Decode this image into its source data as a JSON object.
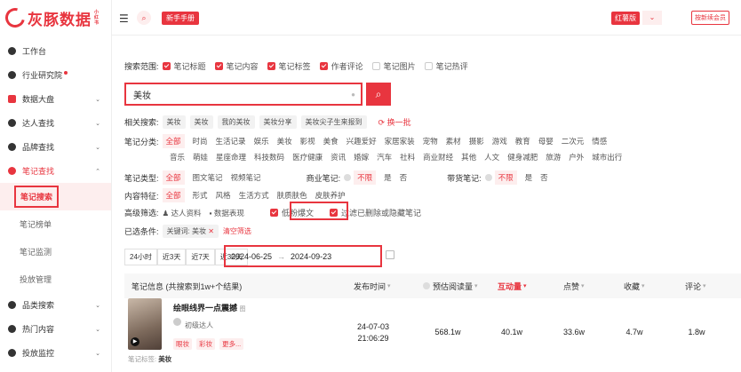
{
  "app": {
    "logo_text": "灰豚数据",
    "logo_small": [
      "小",
      "红",
      "书"
    ]
  },
  "sidebar": {
    "items": [
      {
        "label": "工作台",
        "chev": ""
      },
      {
        "label": "行业研究院",
        "chev": ""
      },
      {
        "label": "数据大盘",
        "chev": "⌄"
      },
      {
        "label": "达人查找",
        "chev": "⌄"
      },
      {
        "label": "品牌查找",
        "chev": "⌄"
      },
      {
        "label": "笔记查找",
        "chev": "⌃"
      }
    ],
    "subitems": [
      "笔记搜索",
      "笔记榜单",
      "笔记监测",
      "投放管理"
    ],
    "bottom": [
      {
        "label": "品类搜索",
        "chev": "⌄"
      },
      {
        "label": "热门内容",
        "chev": "⌄"
      },
      {
        "label": "投放监控",
        "chev": "⌄"
      }
    ]
  },
  "topbar": {
    "menu_icon": "☰",
    "search_icon": "⌕",
    "new_btn": "新手手册",
    "vip": "红薯版",
    "vip_chev": "⌄",
    "renew": "按新续会员"
  },
  "search": {
    "scope_label": "搜索范围:",
    "scope": [
      {
        "label": "笔记标题",
        "on": true
      },
      {
        "label": "笔记内容",
        "on": true
      },
      {
        "label": "笔记标签",
        "on": true
      },
      {
        "label": "作者评论",
        "on": true
      },
      {
        "label": "笔记图片",
        "on": false
      },
      {
        "label": "笔记热评",
        "on": false
      }
    ],
    "query": "美妆",
    "clear_icon": "●",
    "button_icon": "⌕"
  },
  "related": {
    "label": "相关搜索:",
    "tags": [
      "美妆",
      "美妆",
      "我的美妆",
      "美妆分享",
      "美妆尖子生来报到"
    ],
    "refresh": "换一批",
    "refresh_icon": "⟳"
  },
  "category": {
    "label": "笔记分类:",
    "row1": [
      "全部",
      "时尚",
      "生活记录",
      "娱乐",
      "美妆",
      "影视",
      "美食",
      "兴趣爱好",
      "家居家装",
      "宠物",
      "素材",
      "摄影",
      "游戏",
      "教育",
      "母婴",
      "二次元",
      "情感"
    ],
    "row2": [
      "音乐",
      "萌娃",
      "星座命理",
      "科技数码",
      "医疗健康",
      "资讯",
      "婚嫁",
      "汽车",
      "社科",
      "商业财经",
      "其他",
      "人文",
      "健身减肥",
      "旅游",
      "户外",
      "城市出行"
    ]
  },
  "note_type": {
    "label": "笔记类型:",
    "options": [
      "全部",
      "图文笔记",
      "视频笔记"
    ]
  },
  "commercial": {
    "label": "商业笔记:",
    "options": [
      "不限",
      "是",
      "否"
    ]
  },
  "goods": {
    "label": "带货笔记:",
    "options": [
      "不限",
      "是",
      "否"
    ]
  },
  "content": {
    "label": "内容特征:",
    "options": [
      "全部",
      "形式",
      "风格",
      "生活方式",
      "肤质肤色",
      "皮肤养护"
    ]
  },
  "advanced": {
    "label": "高级筛选:",
    "options": [
      "达人资料",
      "数据表现"
    ],
    "fan_low": "低粉爆文",
    "filter_deleted": "过滤已删除或隐藏笔记"
  },
  "conditions": {
    "label": "已选条件:",
    "keyword": "关键词: 美妆",
    "close": "✕",
    "clear": "清空筛选"
  },
  "time": {
    "tabs": [
      "24小时",
      "近3天",
      "近7天",
      "近30天"
    ],
    "start": "2024-06-25",
    "arrow": "→",
    "end": "2024-09-23"
  },
  "table": {
    "headers": [
      "笔记信息 (共搜索到1w+个结果)",
      "发布时间",
      "预估阅读量",
      "互动量",
      "点赞",
      "收藏",
      "评论"
    ],
    "sort_icon": "▾",
    "row": {
      "title": "绘眼线界一点震撼",
      "title_badge": "图",
      "author": "初级达人",
      "tags": [
        "眼妆",
        "彩妆",
        "更多..."
      ],
      "note_tag_label": "笔记标签:",
      "note_tag": "美妆",
      "date": "24-07-03",
      "time": "21:06:29",
      "reads": "568.1w",
      "interactions": "40.1w",
      "likes": "33.6w",
      "favorites": "4.7w",
      "comments": "1.8w",
      "play_icon": "▶"
    }
  },
  "colors": {
    "accent": "#e8353f"
  }
}
